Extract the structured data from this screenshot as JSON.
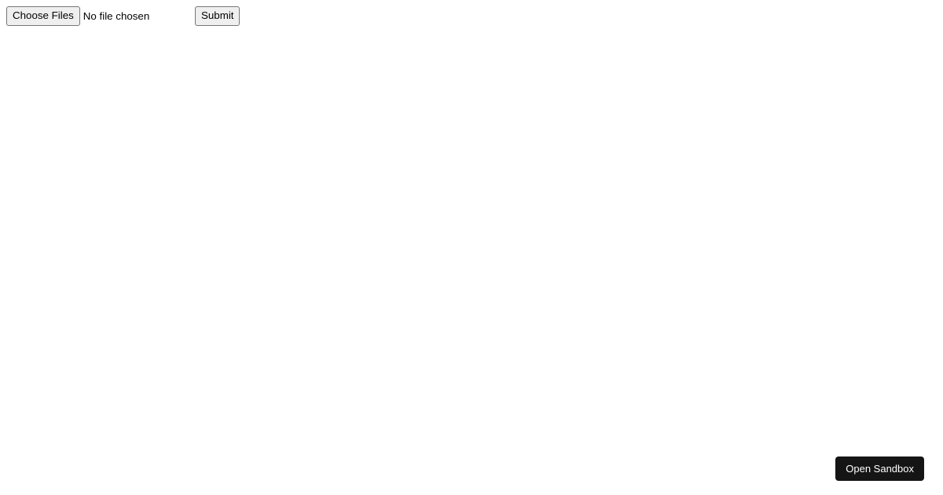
{
  "form": {
    "file_input": {
      "button_label": "Choose Files",
      "status_text": "No file chosen"
    },
    "submit_label": "Submit"
  },
  "sandbox": {
    "open_label": "Open Sandbox"
  }
}
